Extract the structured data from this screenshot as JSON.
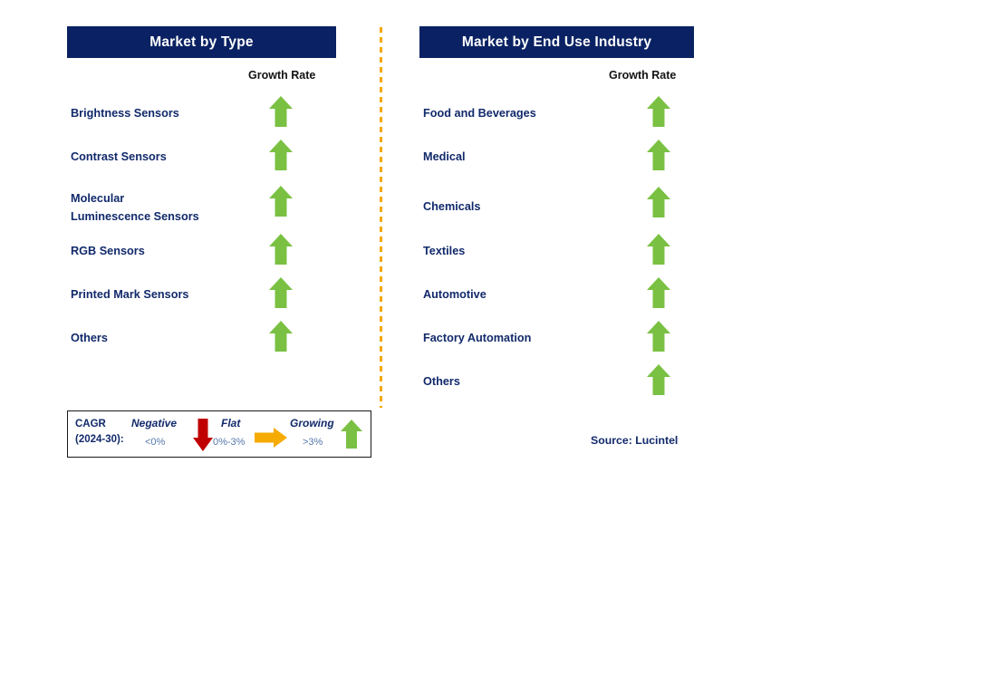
{
  "colors": {
    "header_bg": "#0a2263",
    "header_text": "#ffffff",
    "label_navy": "#122a6b",
    "growth_green": "#7ac143",
    "negative_red": "#c00000",
    "flat_amber": "#f5ab00",
    "divider_orange": "#f5a800",
    "range_text": "#5577aa"
  },
  "panels": [
    {
      "id": "type",
      "title": "Market by Type",
      "growth_rate_label": "Growth Rate",
      "rows": [
        {
          "label": "Brightness Sensors",
          "growth": "growing",
          "icon": "up-arrow-icon"
        },
        {
          "label": "Contrast Sensors",
          "growth": "growing",
          "icon": "up-arrow-icon"
        },
        {
          "label": "Molecular\nLuminescence Sensors",
          "growth": "growing",
          "icon": "up-arrow-icon"
        },
        {
          "label": "RGB Sensors",
          "growth": "growing",
          "icon": "up-arrow-icon"
        },
        {
          "label": "Printed Mark Sensors",
          "growth": "growing",
          "icon": "up-arrow-icon"
        },
        {
          "label": "Others",
          "growth": "growing",
          "icon": "up-arrow-icon"
        }
      ]
    },
    {
      "id": "enduse",
      "title": "Market by End Use Industry",
      "growth_rate_label": "Growth Rate",
      "rows": [
        {
          "label": "Food and Beverages",
          "growth": "growing",
          "icon": "up-arrow-icon"
        },
        {
          "label": "Medical",
          "growth": "growing",
          "icon": "up-arrow-icon"
        },
        {
          "label": "Chemicals",
          "growth": "growing",
          "icon": "up-arrow-icon"
        },
        {
          "label": "Textiles",
          "growth": "growing",
          "icon": "up-arrow-icon"
        },
        {
          "label": "Automotive",
          "growth": "growing",
          "icon": "up-arrow-icon"
        },
        {
          "label": "Factory Automation",
          "growth": "growing",
          "icon": "up-arrow-icon"
        },
        {
          "label": "Others",
          "growth": "growing",
          "icon": "up-arrow-icon"
        }
      ]
    }
  ],
  "legend": {
    "title": "CAGR\n(2024-30):",
    "entries": [
      {
        "term": "Negative",
        "range": "<0%",
        "icon": "down-arrow-icon",
        "color": "#c00000"
      },
      {
        "term": "Flat",
        "range": "0%-3%",
        "icon": "right-arrow-icon",
        "color": "#f5ab00"
      },
      {
        "term": "Growing",
        "range": ">3%",
        "icon": "up-arrow-icon",
        "color": "#7ac143"
      }
    ]
  },
  "source": "Source: Lucintel"
}
